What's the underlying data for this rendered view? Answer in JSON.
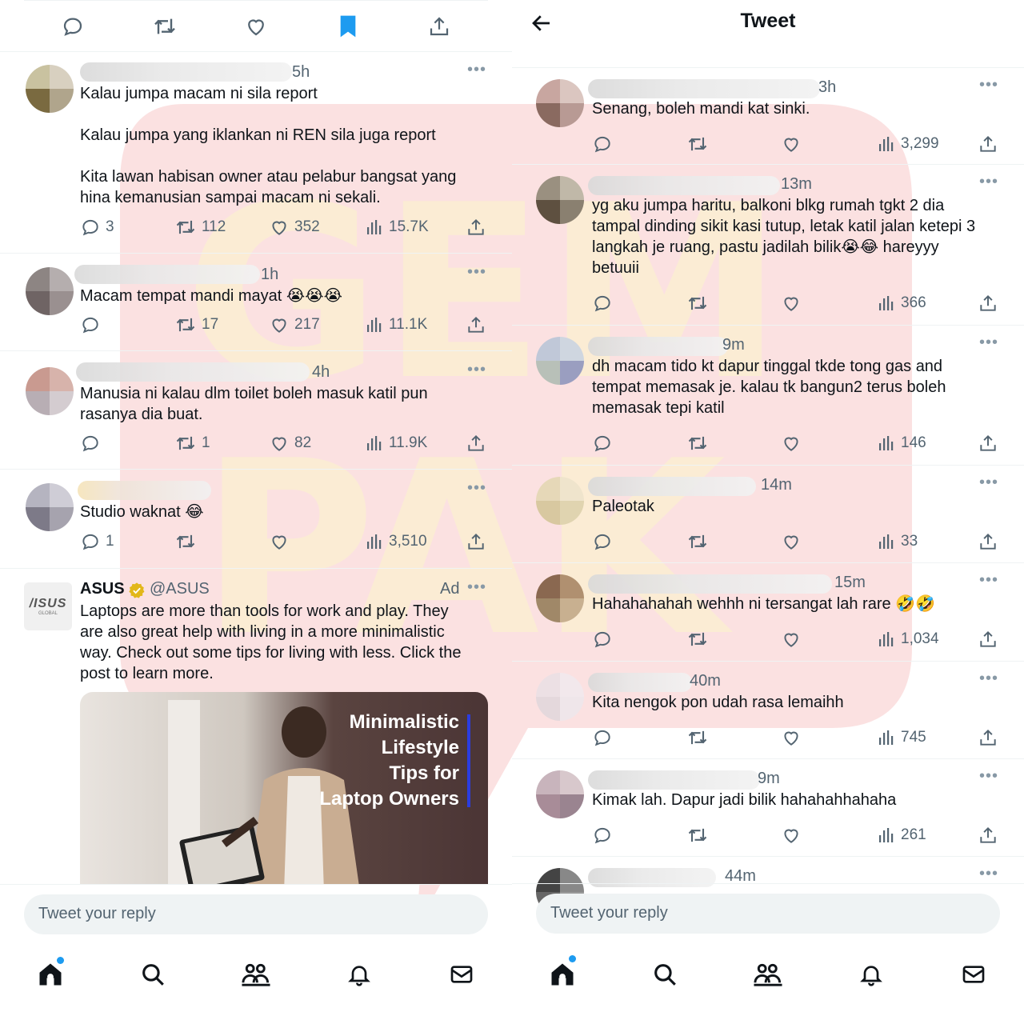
{
  "left": {
    "tweets": [
      {
        "time": "5h",
        "text": "Kalau jumpa macam ni sila report\n\nKalau jumpa yang iklankan ni REN sila juga report\n\nKita lawan habisan owner atau pelabur bangsat yang\nhina kemanusian sampai macam ni sekali.",
        "replies": "3",
        "retweets": "112",
        "likes": "352",
        "views": "15.7K"
      },
      {
        "time": "1h",
        "text": "Macam tempat mandi mayat 😭😭😭",
        "replies": "",
        "retweets": "17",
        "likes": "217",
        "views": "11.1K"
      },
      {
        "time": "4h",
        "text": "Manusia ni kalau dlm toilet boleh masuk katil pun\nrasanya dia buat.",
        "replies": "",
        "retweets": "1",
        "likes": "82",
        "views": "11.9K"
      },
      {
        "time": "",
        "text": "Studio waknat 😂",
        "replies": "1",
        "retweets": "",
        "likes": "",
        "views": "3,510"
      }
    ],
    "ad": {
      "name": "ASUS",
      "handle": "@ASUS",
      "tag": "Ad",
      "logo_text": "/ISUS",
      "logo_sub": "GLOBAL",
      "text": "Laptops are more than tools for work and play. They\nare also great help with living in a more minimalistic\nway. Check out some tips for living with less. Click the\npost to learn more.",
      "card_headline": "Minimalistic\nLifestyle\nTips for\nLaptop Owners"
    },
    "reply_placeholder": "Tweet your reply"
  },
  "right": {
    "header_title": "Tweet",
    "tweets": [
      {
        "time": "3h",
        "text": "Senang, boleh mandi kat sinki.",
        "views": "3,299"
      },
      {
        "time": "13m",
        "text": "yg aku jumpa haritu, balkoni blkg rumah tgkt 2 dia\ntampal dinding sikit kasi tutup, letak katil jalan ketepi 3\nlangkah je ruang, pastu jadilah bilik😭😂 hareyyy\nbetuuii",
        "views": "366"
      },
      {
        "time": "9m",
        "text": "dh macam tido kt dapur tinggal tkde tong gas and\ntempat memasak je. kalau tk bangun2 terus boleh\nmemasak tepi katil",
        "views": "146"
      },
      {
        "time": "14m",
        "text": "Paleotak",
        "views": "33"
      },
      {
        "time": "15m",
        "text": "Hahahahahah wehhh ni tersangat lah rare 🤣🤣",
        "views": "1,034"
      },
      {
        "time": "40m",
        "text": "Kita nengok pon udah rasa lemaihh",
        "views": "745"
      },
      {
        "time": "9m",
        "text": "Kimak lah. Dapur jadi bilik hahahahhahaha",
        "views": "261"
      },
      {
        "time": "44m",
        "text": "",
        "views": ""
      }
    ],
    "reply_placeholder": "Tweet your reply"
  },
  "colors": {
    "accent": "#1d9bf0",
    "text": "#0f1419",
    "muted": "#536471",
    "watermark": "#f5b8b8"
  }
}
